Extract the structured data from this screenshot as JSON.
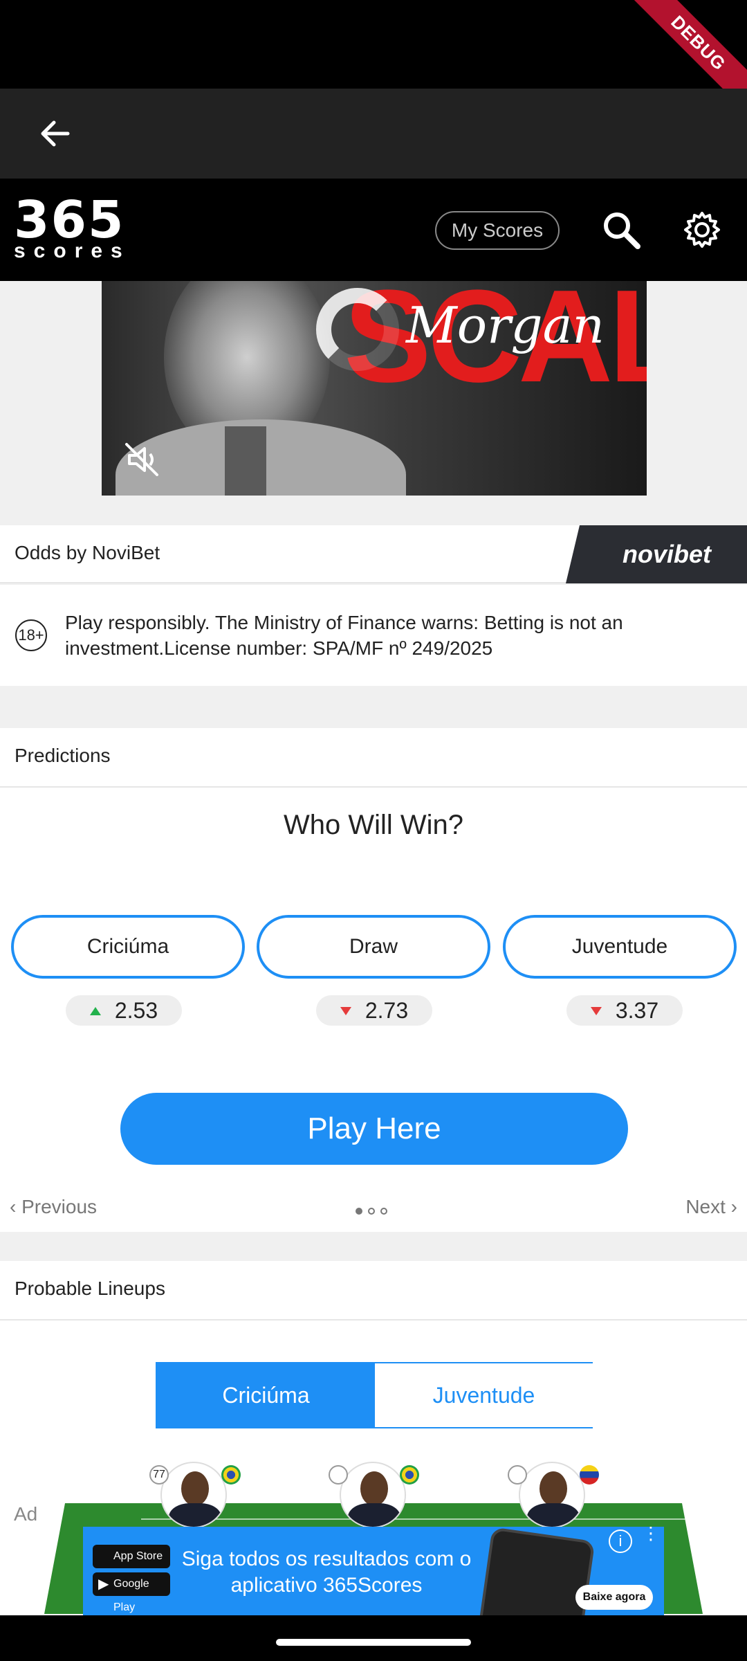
{
  "status_bar": {
    "debug_label": "DEBUG"
  },
  "app_bar": {
    "back_icon": "back-arrow-icon"
  },
  "brand": {
    "logo_number": "365",
    "logo_word": "scores",
    "my_scores_label": "My Scores",
    "search_icon": "search-icon",
    "settings_icon": "gear-icon"
  },
  "promo": {
    "script_text": "Morgan",
    "big_text": "SCALLEY",
    "mute_icon": "mute-icon"
  },
  "odds": {
    "title": "Odds by NoviBet",
    "brand_logo": "novibet",
    "age_badge": "18+",
    "disclaimer": "Play responsibly. The Ministry of Finance warns: Betting is not an investment.License number: SPA/MF nº 249/2025"
  },
  "predictions": {
    "title": "Predictions",
    "question": "Who Will Win?",
    "options": [
      {
        "label": "Criciúma",
        "odd": "2.53",
        "trend": "up"
      },
      {
        "label": "Draw",
        "odd": "2.73",
        "trend": "down"
      },
      {
        "label": "Juventude",
        "odd": "3.37",
        "trend": "down"
      }
    ],
    "play_label": "Play Here",
    "previous_label": "Previous",
    "next_label": "Next",
    "page_dots": 3,
    "active_dot": 1
  },
  "lineups": {
    "title": "Probable Lineups",
    "tabs": [
      "Criciúma",
      "Juventude"
    ],
    "active_tab": "Criciúma",
    "captain_number": "77"
  },
  "ad": {
    "label": "Ad",
    "app_store": "App Store",
    "google_play": "Google Play",
    "headline": "Siga todos os resultados com o aplicativo 365Scores",
    "cta": "Baixe agora",
    "info_icon": "info-icon"
  },
  "colors": {
    "accent": "#1e8ff5",
    "up": "#22b14c",
    "down": "#e53b3b",
    "brand_bar": "#000000"
  }
}
